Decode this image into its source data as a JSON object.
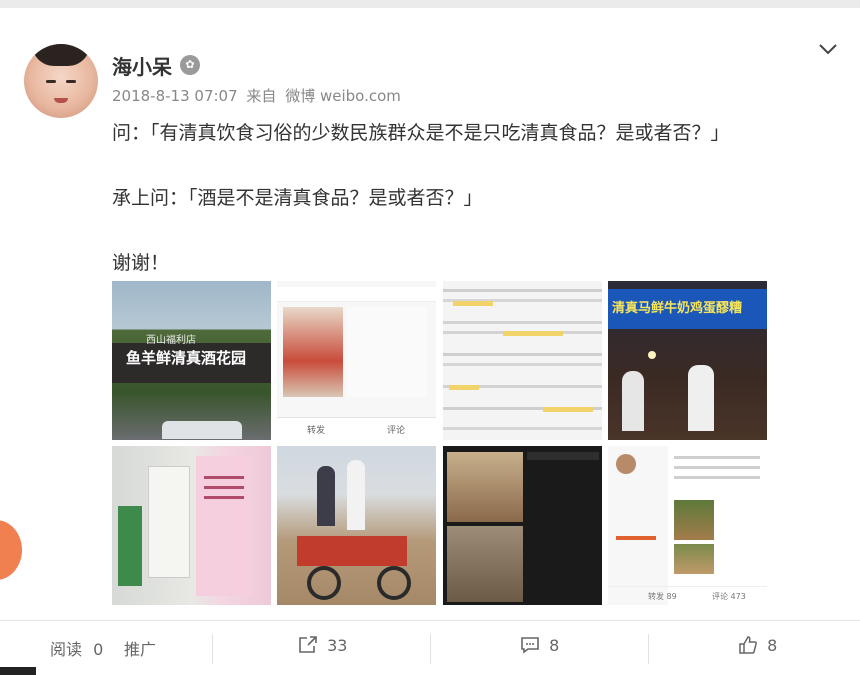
{
  "post": {
    "username": "海小呆",
    "badge_icon": "verified-badge-icon",
    "timestamp": "2018-8-13 07:07",
    "source_prefix": "来自",
    "source": "微博 weibo.com",
    "lines": [
      "问：「有清真饮食习俗的少数民族群众是不是只吃清真食品？是或者否？」",
      "承上问：「酒是不是清真食品？是或者否？」",
      "谢谢！"
    ]
  },
  "images": {
    "count": 8,
    "tile1_sign": "鱼羊鲜清真酒花园",
    "tile1_sign_small": "西山福利店",
    "tile4_sign": "清真马鲜牛奶鸡蛋醪糟",
    "tile2_toolbar": [
      "转发",
      "评论"
    ],
    "tile8_footer": [
      "转发 89",
      "评论 473"
    ]
  },
  "footer": {
    "read_label": "阅读",
    "read_count": "0",
    "promote_label": "推广",
    "share_count": "33",
    "comment_count": "8",
    "like_count": "8"
  },
  "colors": {
    "accent_orange": "#f08050",
    "text": "#333333",
    "meta": "#888888"
  }
}
